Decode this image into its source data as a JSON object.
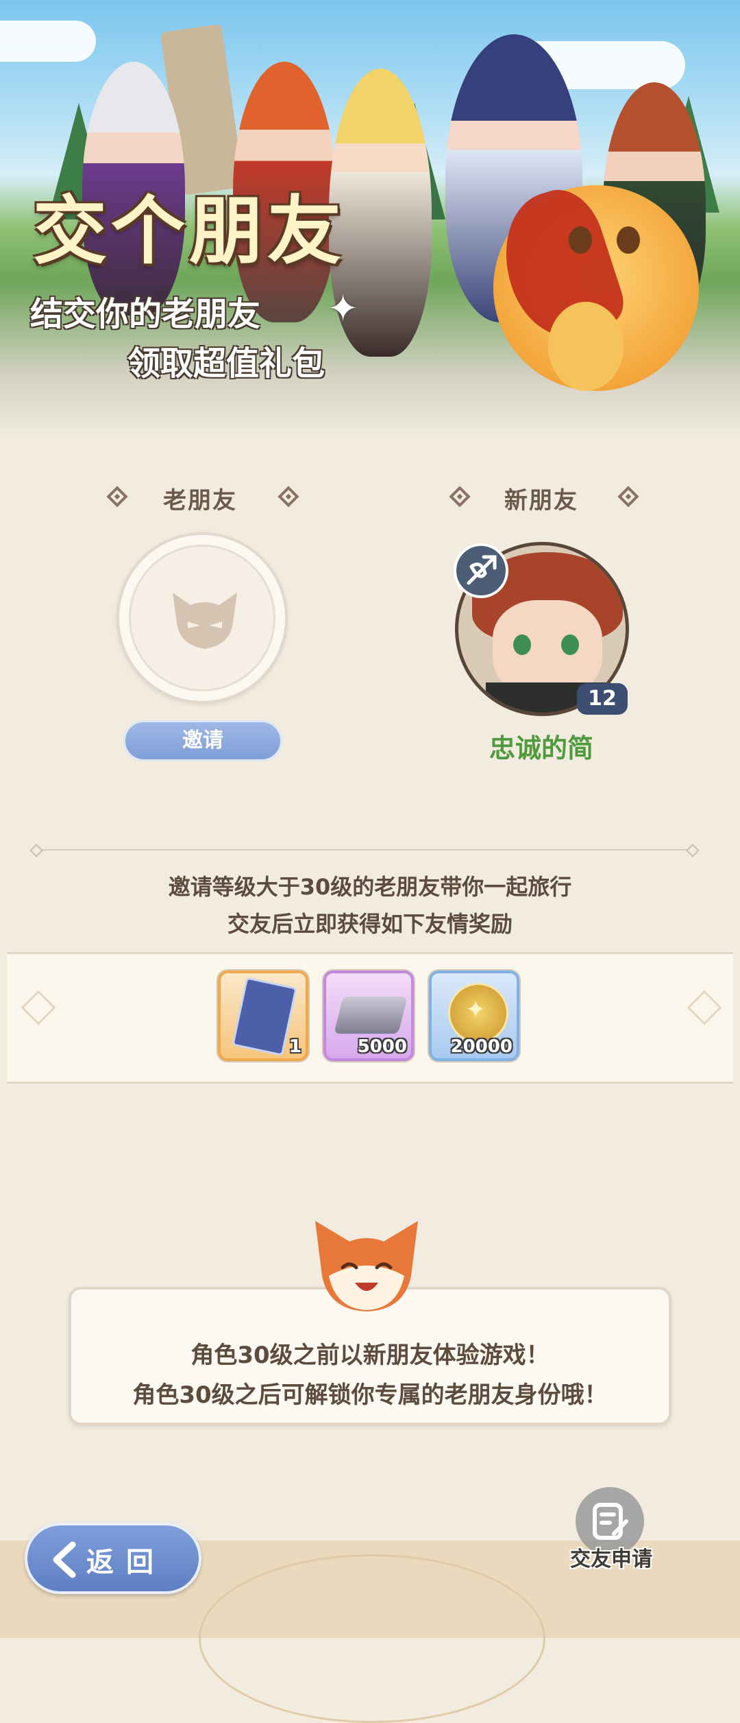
{
  "hero": {
    "title": "交个朋友",
    "subtitle_line1": "结交你的老朋友",
    "subtitle_line2": "领取超值礼包"
  },
  "old_friend": {
    "heading": "老朋友",
    "invite_label": "邀请"
  },
  "new_friend": {
    "heading": "新朋友",
    "name": "忠诚的简",
    "level": "12",
    "class_icon": "crossbow-icon"
  },
  "info": {
    "line1": "邀请等级大于30级的老朋友带你一起旅行",
    "line2": "交友后立即获得如下友情奖励"
  },
  "rewards": [
    {
      "icon": "card-icon",
      "count": "1",
      "frame_color": "#f2a94a"
    },
    {
      "icon": "silver-bar-icon",
      "count": "5000",
      "frame_color": "#c487e0"
    },
    {
      "icon": "gold-coin-icon",
      "count": "20000",
      "frame_color": "#7fb2e6"
    }
  ],
  "tip": {
    "line1": "角色30级之前以新朋友体验游戏！",
    "line2": "角色30级之后可解锁你专属的老朋友身份哦！"
  },
  "footer": {
    "back_label": "返回",
    "apply_label": "交友申请"
  },
  "colors": {
    "accent_blue": "#7f9fd9",
    "name_green": "#4f9a3c",
    "background": "#f1ebe0"
  }
}
